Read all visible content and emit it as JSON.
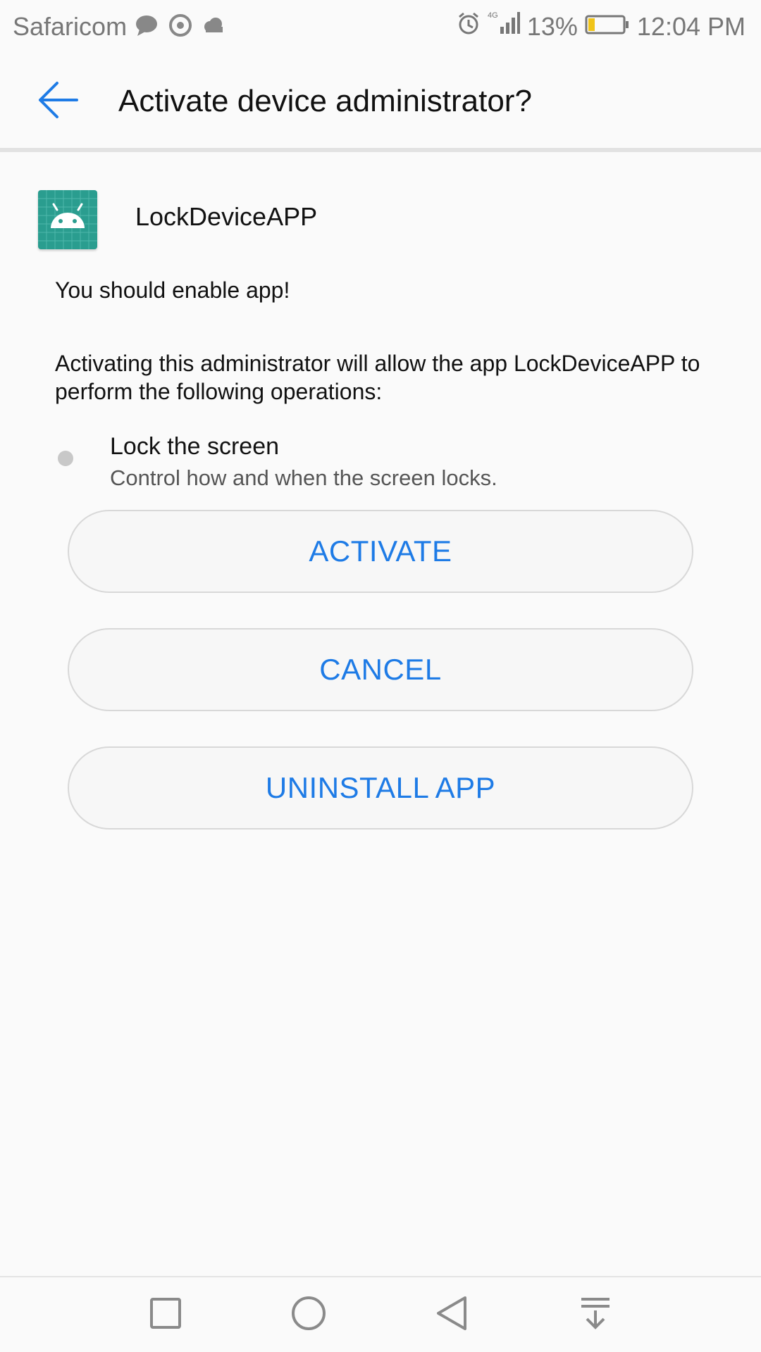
{
  "status_bar": {
    "carrier": "Safaricom",
    "network": "4G",
    "battery": "13%",
    "time": "12:04 PM",
    "left_icons": [
      "message-icon",
      "chrome-icon",
      "cloud-icon"
    ],
    "right_icons": [
      "alarm-icon",
      "signal-icon",
      "battery-icon"
    ]
  },
  "header": {
    "title": "Activate device administrator?",
    "back_icon": "arrow-left-icon"
  },
  "app": {
    "name": "LockDeviceAPP",
    "icon": "android-icon"
  },
  "message": "You should enable app!",
  "description": "Activating this administrator will allow the app LockDeviceAPP to perform the following operations:",
  "policies": [
    {
      "title": "Lock the screen",
      "description": "Control how and when the screen locks."
    }
  ],
  "buttons": {
    "activate": "ACTIVATE",
    "cancel": "CANCEL",
    "uninstall": "UNINSTALL APP"
  },
  "nav_bar": {
    "icons": [
      "square-icon",
      "circle-icon",
      "triangle-back-icon",
      "notification-pull-icon"
    ]
  },
  "colors": {
    "accent": "#1e7be6",
    "app_icon": "#2a9d8f",
    "background": "#fafafa"
  }
}
